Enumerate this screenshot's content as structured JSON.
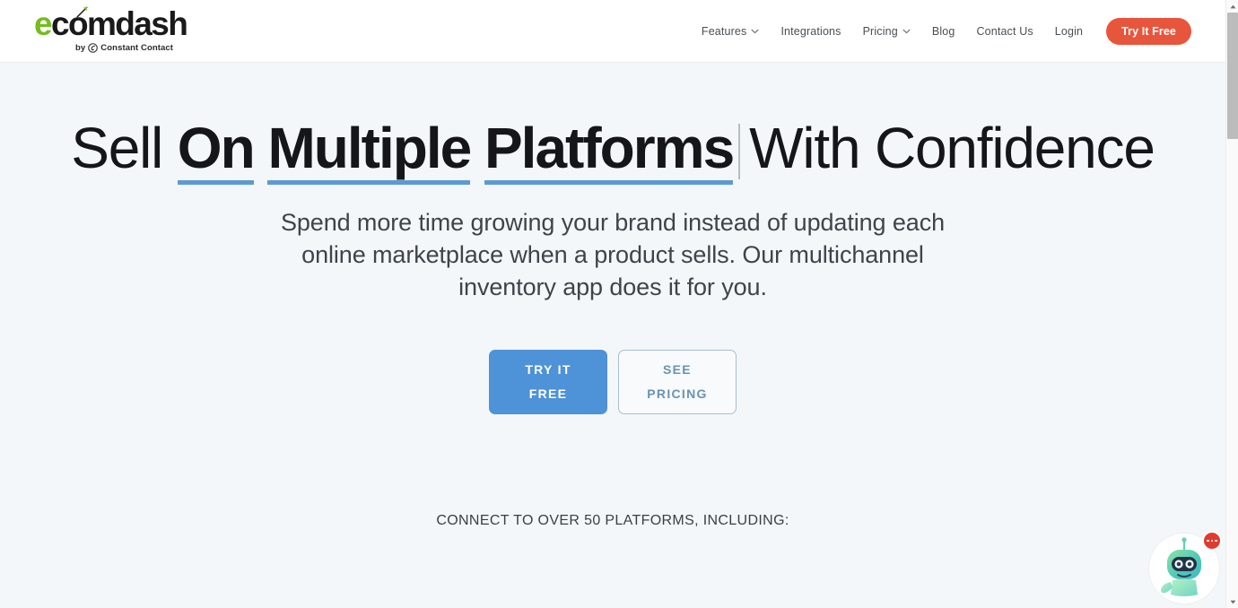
{
  "header": {
    "logo": {
      "wordmark_pre": "e",
      "wordmark_c": "c",
      "wordmark_o": "o",
      "wordmark_post": "mdash",
      "byline_prefix": "by",
      "byline_brand": "Constant Contact"
    },
    "nav": [
      {
        "label": "Features",
        "has_dropdown": true
      },
      {
        "label": "Integrations",
        "has_dropdown": false
      },
      {
        "label": "Pricing",
        "has_dropdown": true
      },
      {
        "label": "Blog",
        "has_dropdown": false
      },
      {
        "label": "Contact Us",
        "has_dropdown": false
      },
      {
        "label": "Login",
        "has_dropdown": false
      }
    ],
    "cta_label": "Try It Free"
  },
  "hero": {
    "title_lead": "Sell",
    "title_accent_word1": "On",
    "title_accent_word2": "Multiple",
    "title_accent_word3": "Platforms",
    "title_tail": "With Confidence",
    "subtitle": "Spend more time growing your brand instead of updating each online marketplace when a product sells. Our multichannel inventory app does it for you.",
    "primary_button": "TRY IT FREE",
    "secondary_button": "SEE PRICING",
    "connect_text": "CONNECT TO OVER 50 PLATFORMS, INCLUDING:"
  },
  "chat": {
    "avatar_name": "robot-assistant-avatar",
    "badge_dots": "..."
  },
  "colors": {
    "accent_orange": "#e8553d",
    "accent_blue": "#4e92d8",
    "underline_blue": "#5b9bd5",
    "logo_green": "#76bc21",
    "hero_background": "#f4f7fa",
    "badge_red": "#e03b2f"
  }
}
